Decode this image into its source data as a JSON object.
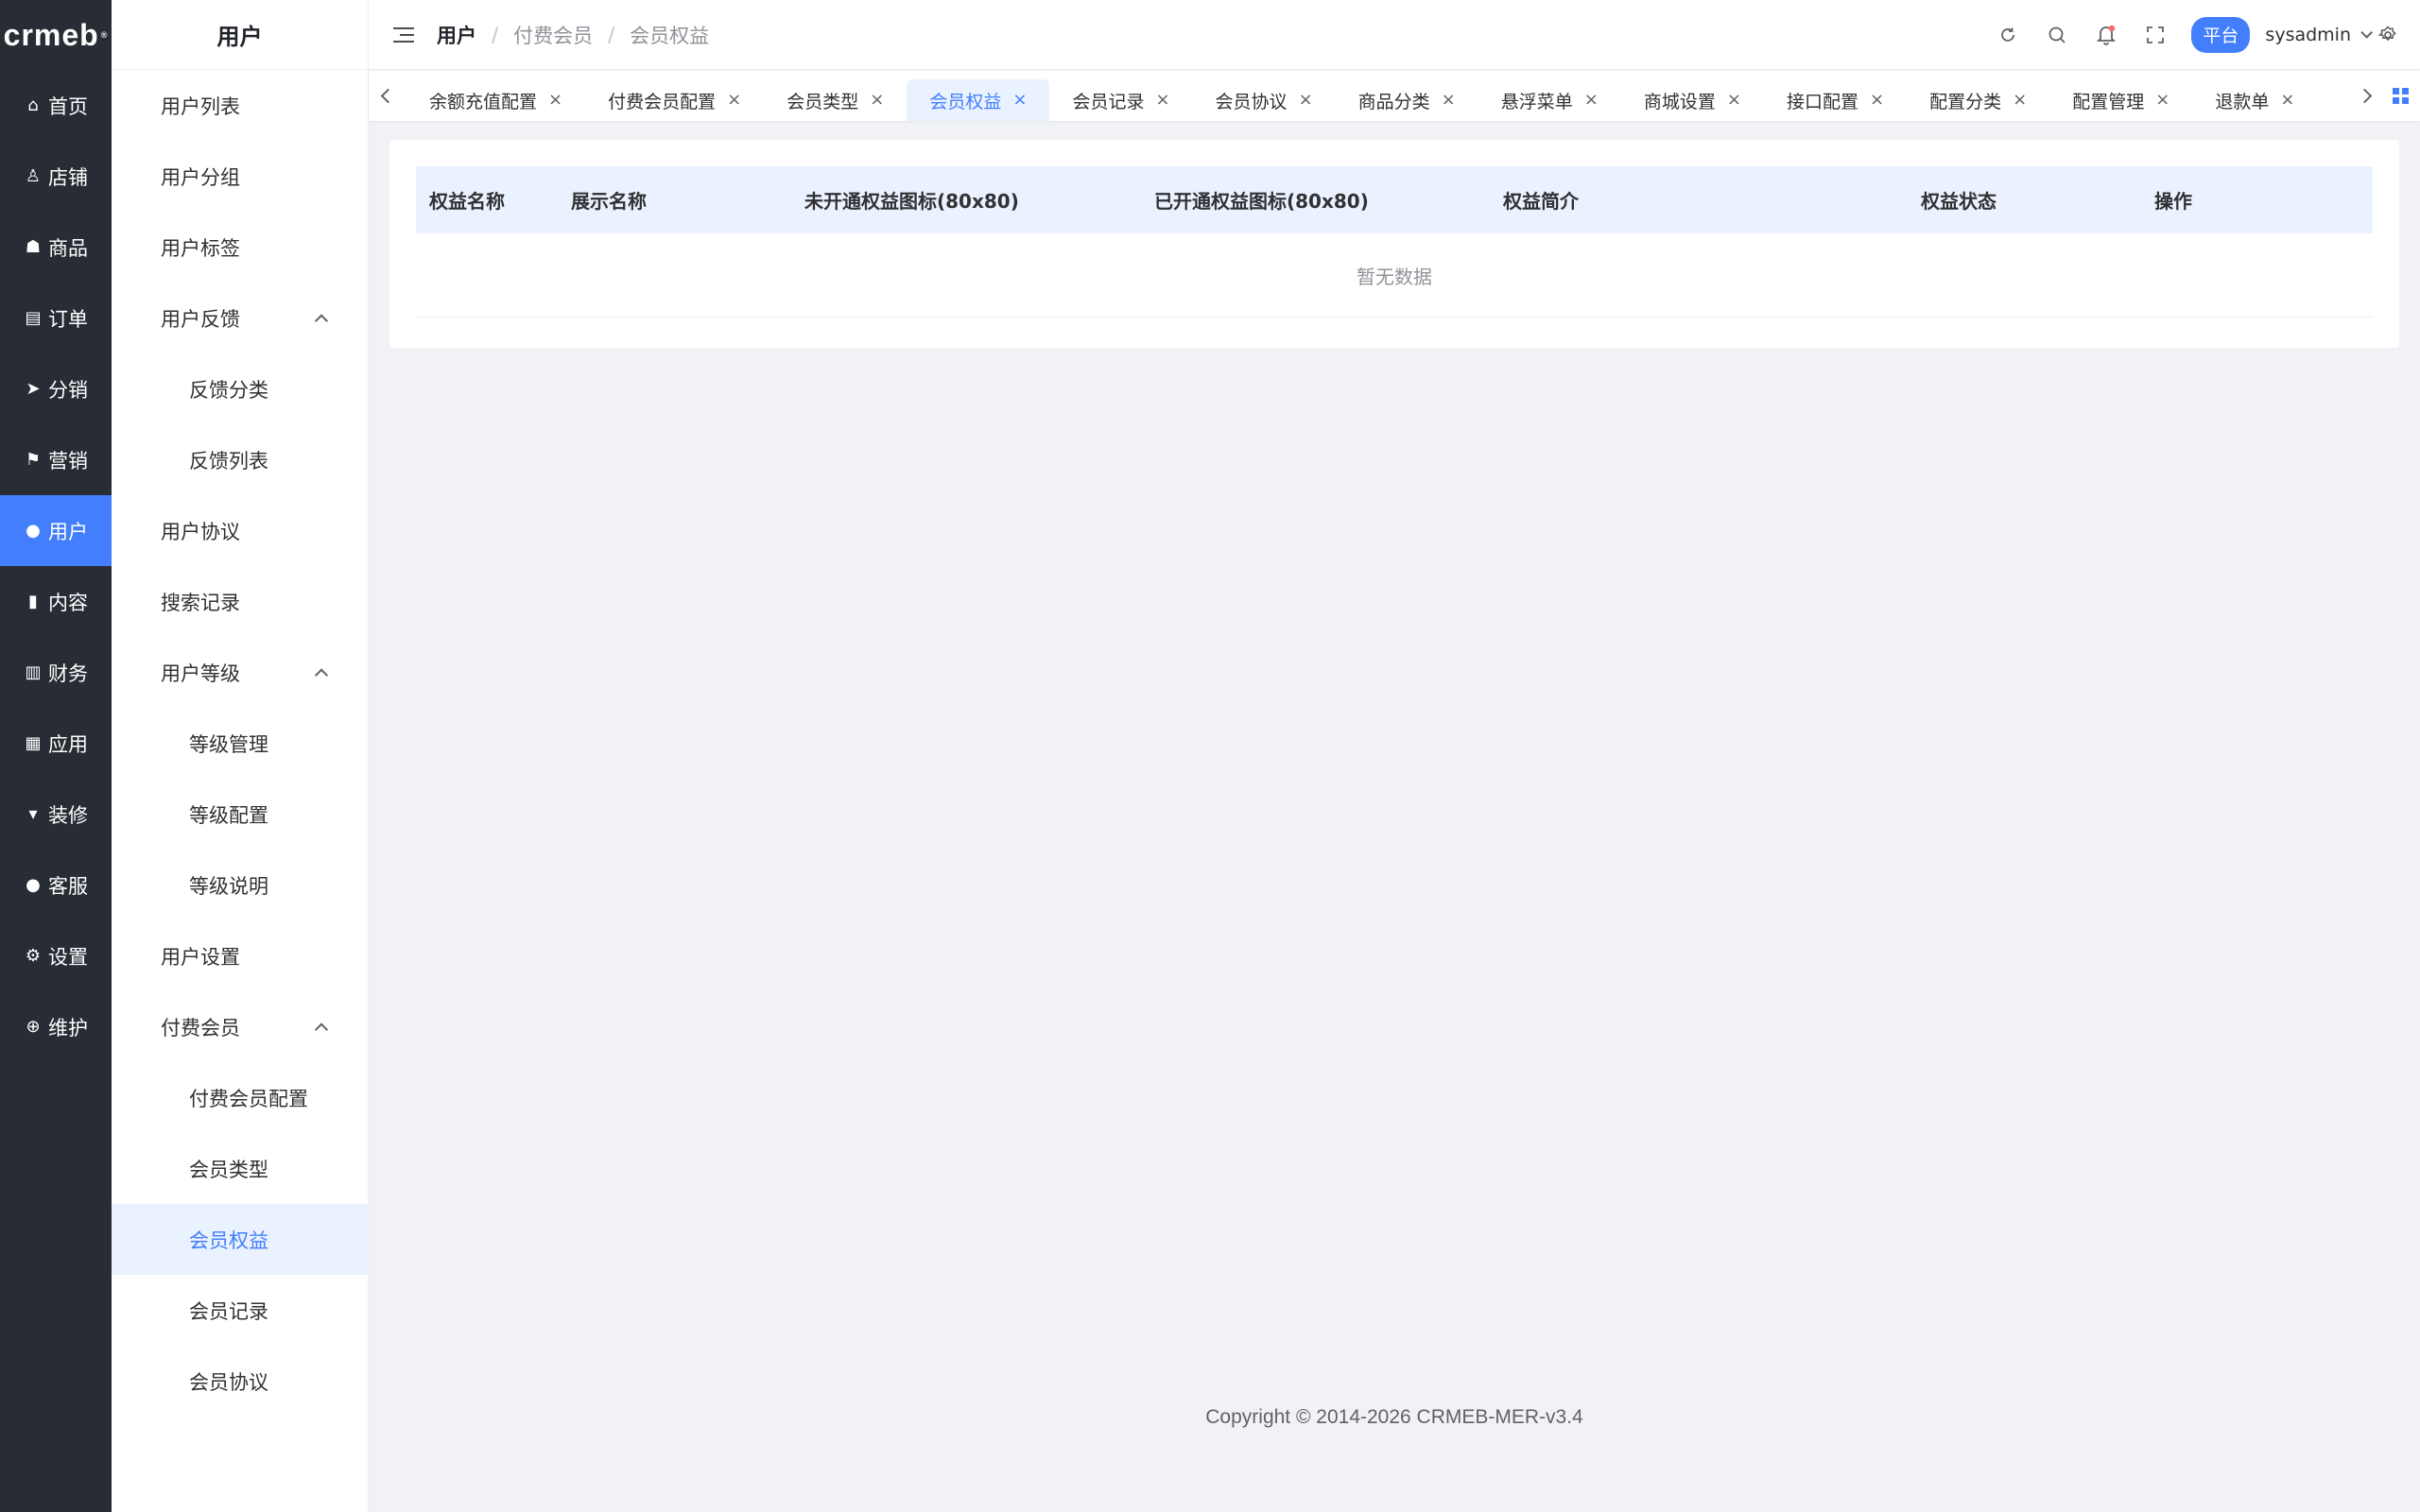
{
  "logo": {
    "text": "crmeb",
    "mark": "®"
  },
  "rail": {
    "items": [
      {
        "label": "首页",
        "icon": "home-icon",
        "glyph": "⌂"
      },
      {
        "label": "店铺",
        "icon": "store-icon",
        "glyph": "♙"
      },
      {
        "label": "商品",
        "icon": "bag-icon",
        "glyph": "☗"
      },
      {
        "label": "订单",
        "icon": "clipboard-icon",
        "glyph": "▤"
      },
      {
        "label": "分销",
        "icon": "send-icon",
        "glyph": "➤"
      },
      {
        "label": "营销",
        "icon": "flag-icon",
        "glyph": "⚑"
      },
      {
        "label": "用户",
        "icon": "user-icon",
        "glyph": "●"
      },
      {
        "label": "内容",
        "icon": "book-icon",
        "glyph": "▮"
      },
      {
        "label": "财务",
        "icon": "bar-chart-icon",
        "glyph": "▥"
      },
      {
        "label": "应用",
        "icon": "apps-grid-icon",
        "glyph": "▦"
      },
      {
        "label": "装修",
        "icon": "brush-icon",
        "glyph": "▾"
      },
      {
        "label": "客服",
        "icon": "support-user-icon",
        "glyph": "●"
      },
      {
        "label": "设置",
        "icon": "gear-icon",
        "glyph": "⚙"
      },
      {
        "label": "维护",
        "icon": "plus-circle-icon",
        "glyph": "⊕"
      }
    ],
    "active_index": 6
  },
  "submenu": {
    "title": "用户",
    "items": [
      {
        "label": "用户列表",
        "level": 1
      },
      {
        "label": "用户分组",
        "level": 1
      },
      {
        "label": "用户标签",
        "level": 1
      },
      {
        "label": "用户反馈",
        "level": 1,
        "expanded": true
      },
      {
        "label": "反馈分类",
        "level": 2
      },
      {
        "label": "反馈列表",
        "level": 2
      },
      {
        "label": "用户协议",
        "level": 1
      },
      {
        "label": "搜索记录",
        "level": 1
      },
      {
        "label": "用户等级",
        "level": 1,
        "expanded": true
      },
      {
        "label": "等级管理",
        "level": 2
      },
      {
        "label": "等级配置",
        "level": 2
      },
      {
        "label": "等级说明",
        "level": 2
      },
      {
        "label": "用户设置",
        "level": 1
      },
      {
        "label": "付费会员",
        "level": 1,
        "expanded": true
      },
      {
        "label": "付费会员配置",
        "level": 2
      },
      {
        "label": "会员类型",
        "level": 2
      },
      {
        "label": "会员权益",
        "level": 2,
        "active": true
      },
      {
        "label": "会员记录",
        "level": 2
      },
      {
        "label": "会员协议",
        "level": 2
      }
    ]
  },
  "header": {
    "breadcrumb": [
      "用户",
      "付费会员",
      "会员权益"
    ],
    "platform_label": "平台",
    "username": "sysadmin",
    "accent": "#437ffd"
  },
  "tabs": {
    "items": [
      "余额充值配置",
      "付费会员配置",
      "会员类型",
      "会员权益",
      "会员记录",
      "会员协议",
      "商品分类",
      "悬浮菜单",
      "商城设置",
      "接口配置",
      "配置分类",
      "配置管理",
      "退款单"
    ],
    "active_index": 3,
    "close_glyph": "×"
  },
  "table": {
    "columns": [
      "权益名称",
      "展示名称",
      "未开通权益图标(80x80)",
      "已开通权益图标(80x80)",
      "权益简介",
      "权益状态",
      "操作"
    ],
    "empty_text": "暂无数据"
  },
  "footer": {
    "copyright": "Copyright © 2014-2026 CRMEB-MER-v3.4"
  }
}
